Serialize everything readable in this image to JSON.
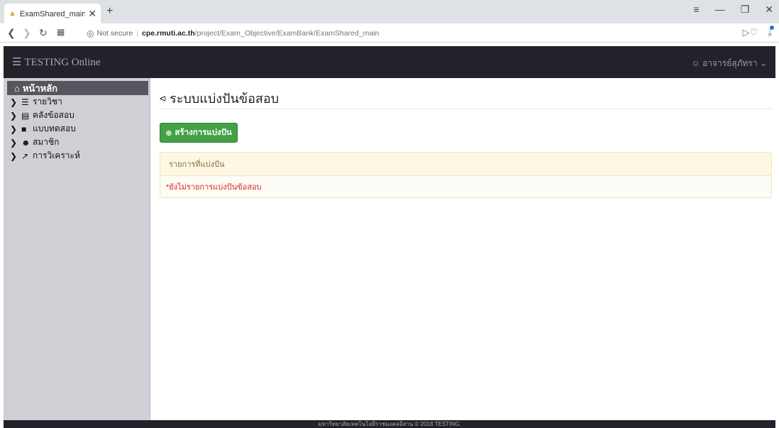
{
  "browser": {
    "tab_title": "ExamShared_main ระบบวิเค",
    "new_tab": "+",
    "url_security": "Not secure",
    "url_host": "cpe.rmuti.ac.th",
    "url_path": "/project/Exam_Objective/ExamBank/ExamShared_main"
  },
  "navbar": {
    "brand": "TESTING Online",
    "user": "อาจารย์สุภัทรา"
  },
  "sidebar": {
    "home": "หน้าหลัก",
    "items": [
      {
        "label": "รายวิชา",
        "icon": "list-icon"
      },
      {
        "label": "คลังข้อสอบ",
        "icon": "database-icon"
      },
      {
        "label": "แบบทดสอบ",
        "icon": "book-icon"
      },
      {
        "label": "สมาชิก",
        "icon": "users-icon"
      },
      {
        "label": "การวิเคราะห์",
        "icon": "chart-icon"
      }
    ]
  },
  "main": {
    "title": "ระบบแบ่งปันข้อสอบ",
    "create_button": "สร้างการแบ่งปัน",
    "panel_heading": "รายการที่แบ่งปัน",
    "empty_message": "*ยังไม่รายการแบ่งปันข้อสอบ"
  },
  "footer": {
    "text": "มหาวิทยาลัยเทคโนโลยีราชมงคลอีสาน © 2018 TESTING."
  }
}
